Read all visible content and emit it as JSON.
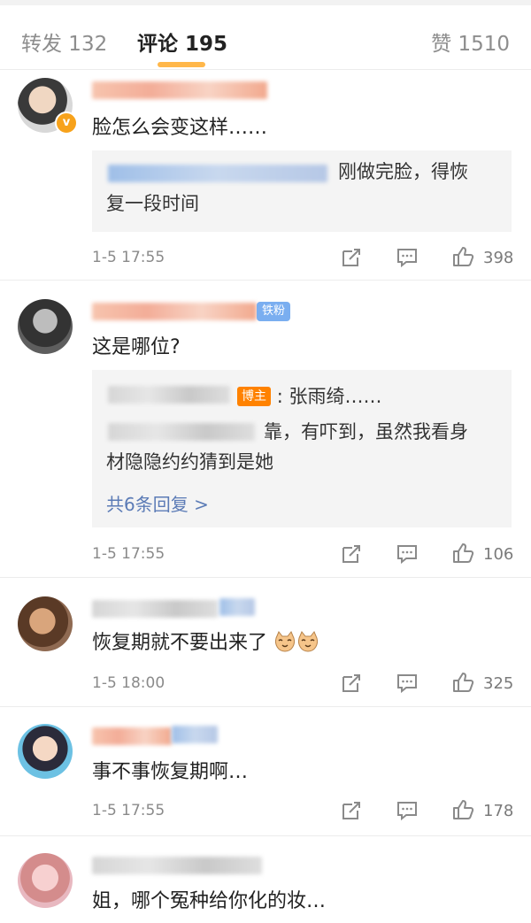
{
  "tabs": {
    "repost": "转发 132",
    "comments": "评论 195",
    "likes": "赞 1510"
  },
  "comments": [
    {
      "text": "脸怎么会变这样……",
      "reply": {
        "line1": "刚做完脸，得恢",
        "line2": "复一段时间"
      },
      "time": "1-5 17:55",
      "likes": "398"
    },
    {
      "fan_badge": "铁粉",
      "text": "这是哪位?",
      "reply": {
        "blogger_badge": "博主",
        "line1": ": 张雨绮……",
        "line2": "靠，有吓到，虽然我看身",
        "line3": "材隐隐约约猜到是她",
        "more": "共6条回复 >"
      },
      "time": "1-5 17:55",
      "likes": "106"
    },
    {
      "text": "恢复期就不要出来了",
      "time": "1-5 18:00",
      "likes": "325"
    },
    {
      "text": "事不事恢复期啊…",
      "time": "1-5 17:55",
      "likes": "178"
    },
    {
      "text": "姐，哪个冤种给你化的妆…"
    }
  ],
  "icons": {
    "repost": "repost-icon",
    "reply": "comment-icon",
    "like": "thumbs-up-icon",
    "verified": "verified-badge-icon",
    "emoji": "cat-face-emoji-icon"
  },
  "colors": {
    "accent": "#ffb74a",
    "link": "#5b7bb6",
    "blogger_badge": "#ff8200",
    "fan_badge": "#7aaef0"
  }
}
